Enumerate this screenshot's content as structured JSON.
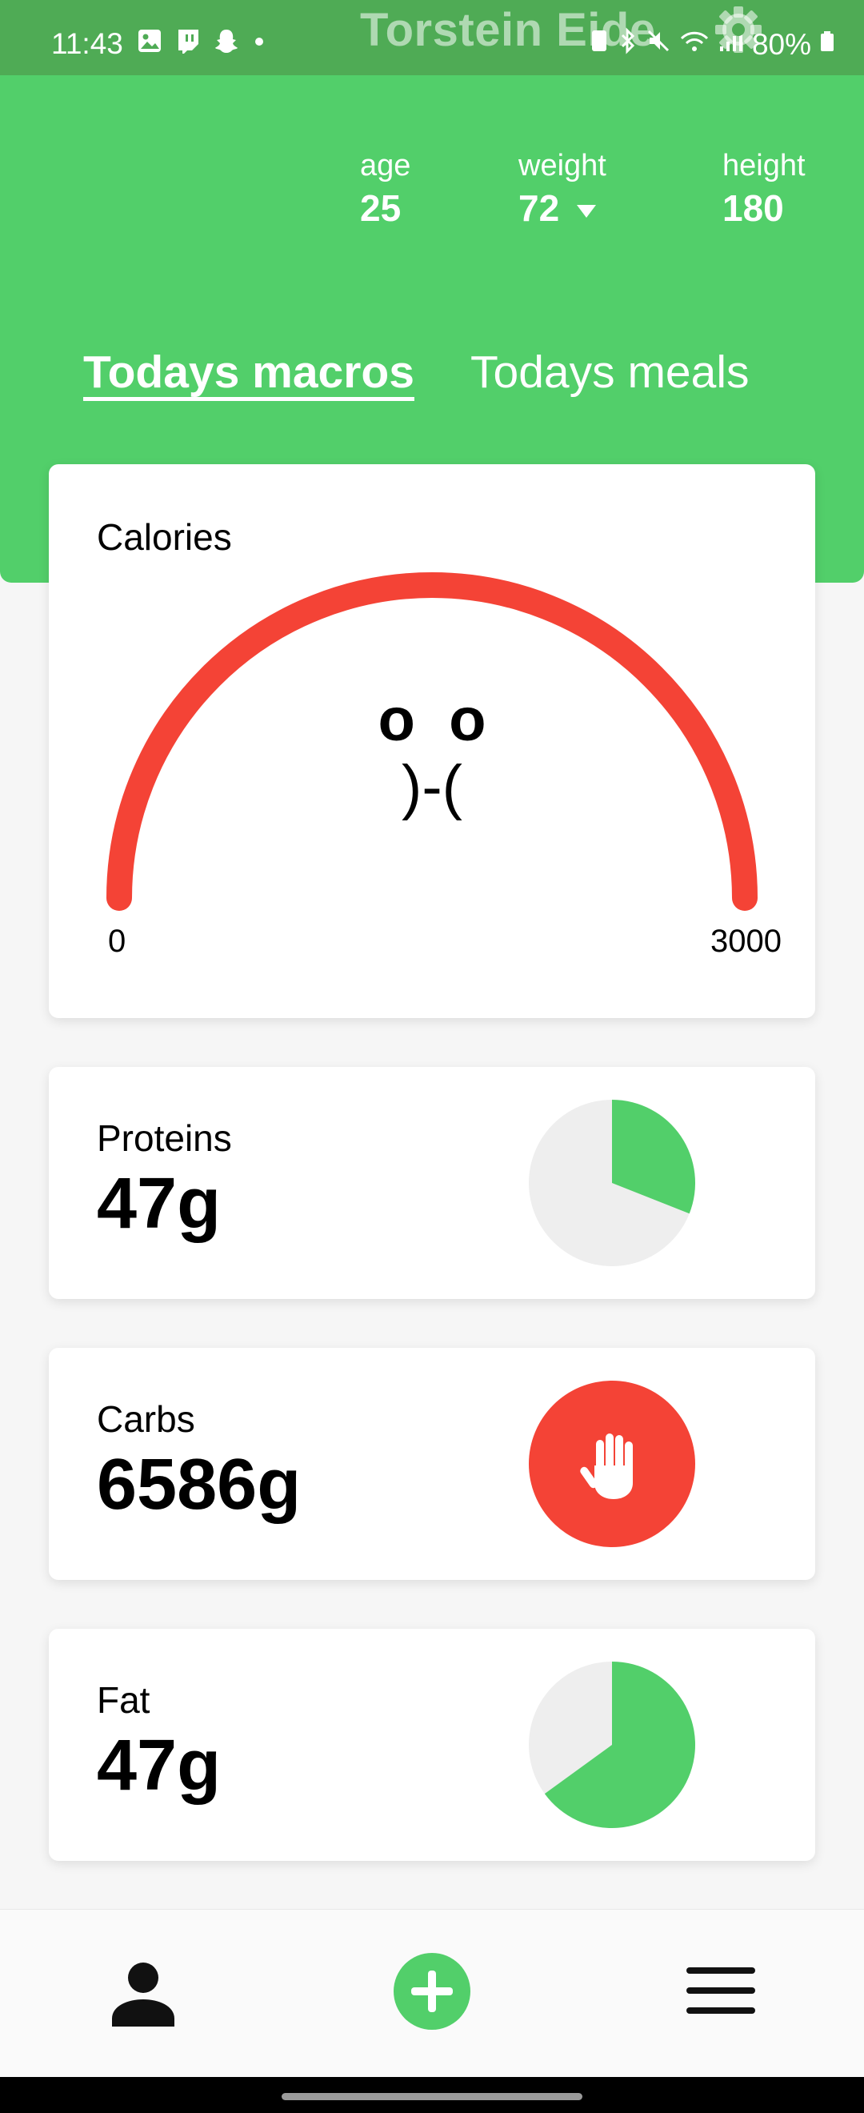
{
  "status_bar": {
    "time": "11:43",
    "battery": "80%"
  },
  "user": {
    "name": "Torstein Eide"
  },
  "stats": {
    "age_label": "age",
    "age_value": "25",
    "weight_label": "weight",
    "weight_value": "72",
    "height_label": "height",
    "height_value": "180"
  },
  "tabs": {
    "macros": "Todays macros",
    "meals": "Todays meals",
    "active": "macros"
  },
  "calories": {
    "label": "Calories",
    "face_eyes": "o  o",
    "face_mouth": ")-(",
    "min_label": "0",
    "max_label": "3000",
    "min": 0,
    "max": 3000,
    "progress": 1.0,
    "gauge_color": "#f44336"
  },
  "proteins": {
    "label": "Proteins",
    "value": "47g",
    "fraction": 0.31
  },
  "carbs": {
    "label": "Carbs",
    "value": "6586g",
    "over_limit": true,
    "icon": "hand-stop-icon"
  },
  "fat": {
    "label": "Fat",
    "value": "47g",
    "fraction": 0.65
  },
  "colors": {
    "accent": "#52cf6a",
    "danger": "#f44336",
    "pie_track": "#eeeeee"
  },
  "nav": {
    "left_icon": "profile-icon",
    "center_icon": "add-icon",
    "right_icon": "menu-icon"
  }
}
